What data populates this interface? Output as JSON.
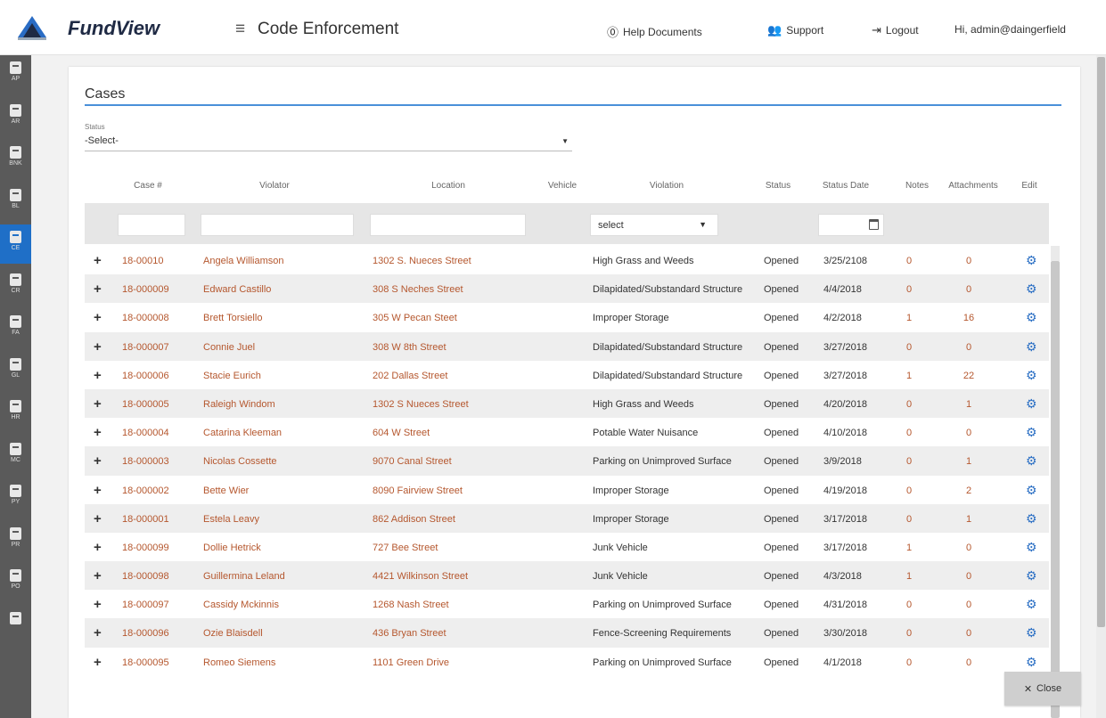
{
  "app": {
    "brand": "FundView",
    "module_title": "Code Enforcement"
  },
  "topnav": {
    "help": "Help Documents",
    "support": "Support",
    "logout": "Logout",
    "greeting": "Hi, admin@daingerfield"
  },
  "sidebar": {
    "items": [
      {
        "label": "AP",
        "icon": "document-icon"
      },
      {
        "label": "AR",
        "icon": "calendar-icon"
      },
      {
        "label": "BNK",
        "icon": "bank-icon"
      },
      {
        "label": "BL",
        "icon": "check-icon"
      },
      {
        "label": "CE",
        "icon": "badge-icon",
        "active": true
      },
      {
        "label": "CR",
        "icon": "register-icon"
      },
      {
        "label": "FA",
        "icon": "bus-icon"
      },
      {
        "label": "GL",
        "icon": "ledger-icon"
      },
      {
        "label": "HR",
        "icon": "people-icon"
      },
      {
        "label": "MC",
        "icon": "gavel-icon"
      },
      {
        "label": "PY",
        "icon": "group-icon"
      },
      {
        "label": "PR",
        "icon": "home-icon"
      },
      {
        "label": "PO",
        "icon": "card-icon"
      },
      {
        "label": "",
        "icon": "lock-icon"
      }
    ]
  },
  "cases": {
    "title": "Cases",
    "status_label": "Status",
    "status_value": "-Select-",
    "filter_violation_value": "select",
    "columns": {
      "case": "Case #",
      "violator": "Violator",
      "location": "Location",
      "vehicle": "Vehicle",
      "violation": "Violation",
      "status": "Status",
      "status_date": "Status Date",
      "notes": "Notes",
      "attachments": "Attachments",
      "edit": "Edit"
    },
    "rows": [
      {
        "case": "18-00010",
        "violator": "Angela Williamson",
        "location": "1302 S. Nueces Street",
        "violation": "High Grass and Weeds",
        "status": "Opened",
        "date": "3/25/2108",
        "notes": "0",
        "attachments": "0"
      },
      {
        "case": "18-000009",
        "violator": "Edward Castillo",
        "location": "308 S Neches Street",
        "violation": "Dilapidated/Substandard Structure",
        "status": "Opened",
        "date": "4/4/2018",
        "notes": "0",
        "attachments": "0"
      },
      {
        "case": "18-000008",
        "violator": "Brett Torsiello",
        "location": "305 W Pecan Steet",
        "violation": "Improper Storage",
        "status": "Opened",
        "date": "4/2/2018",
        "notes": "1",
        "attachments": "16"
      },
      {
        "case": "18-000007",
        "violator": "Connie Juel",
        "location": "308 W 8th Street",
        "violation": "Dilapidated/Substandard Structure",
        "status": "Opened",
        "date": "3/27/2018",
        "notes": "0",
        "attachments": "0"
      },
      {
        "case": "18-000006",
        "violator": "Stacie Eurich",
        "location": "202 Dallas Street",
        "violation": "Dilapidated/Substandard Structure",
        "status": "Opened",
        "date": "3/27/2018",
        "notes": "1",
        "attachments": "22"
      },
      {
        "case": "18-000005",
        "violator": "Raleigh Windom",
        "location": "1302 S Nueces Street",
        "violation": "High Grass and Weeds",
        "status": "Opened",
        "date": "4/20/2018",
        "notes": "0",
        "attachments": "1"
      },
      {
        "case": "18-000004",
        "violator": "Catarina Kleeman",
        "location": "604 W Street",
        "violation": "Potable Water Nuisance",
        "status": "Opened",
        "date": "4/10/2018",
        "notes": "0",
        "attachments": "0"
      },
      {
        "case": "18-000003",
        "violator": "Nicolas Cossette",
        "location": "9070 Canal Street",
        "violation": "Parking on Unimproved Surface",
        "status": "Opened",
        "date": "3/9/2018",
        "notes": "0",
        "attachments": "1"
      },
      {
        "case": "18-000002",
        "violator": "Bette Wier",
        "location": "8090 Fairview Street",
        "violation": "Improper Storage",
        "status": "Opened",
        "date": "4/19/2018",
        "notes": "0",
        "attachments": "2"
      },
      {
        "case": "18-000001",
        "violator": "Estela Leavy",
        "location": "862 Addison Street",
        "violation": "Improper Storage",
        "status": "Opened",
        "date": "3/17/2018",
        "notes": "0",
        "attachments": "1"
      },
      {
        "case": "18-000099",
        "violator": "Dollie Hetrick",
        "location": "727 Bee Street",
        "violation": "Junk Vehicle",
        "status": "Opened",
        "date": "3/17/2018",
        "notes": "1",
        "attachments": "0"
      },
      {
        "case": "18-000098",
        "violator": "Guillermina Leland",
        "location": "4421 Wilkinson Street",
        "violation": "Junk Vehicle",
        "status": "Opened",
        "date": "4/3/2018",
        "notes": "1",
        "attachments": "0"
      },
      {
        "case": "18-000097",
        "violator": "Cassidy Mckinnis",
        "location": "1268 Nash Street",
        "violation": "Parking on Unimproved Surface",
        "status": "Opened",
        "date": "4/31/2018",
        "notes": "0",
        "attachments": "0"
      },
      {
        "case": "18-000096",
        "violator": "Ozie Blaisdell",
        "location": "436 Bryan Street",
        "violation": "Fence-Screening Requirements",
        "status": "Opened",
        "date": "3/30/2018",
        "notes": "0",
        "attachments": "0"
      },
      {
        "case": "18-000095",
        "violator": "Romeo Siemens",
        "location": "1101 Green Drive",
        "violation": "Parking on Unimproved Surface",
        "status": "Opened",
        "date": "4/1/2018",
        "notes": "0",
        "attachments": "0"
      }
    ]
  },
  "close_label": "Close",
  "colors": {
    "accent": "#1f6fc7",
    "link": "#b5572e",
    "sidebar": "#5a5a5a"
  }
}
